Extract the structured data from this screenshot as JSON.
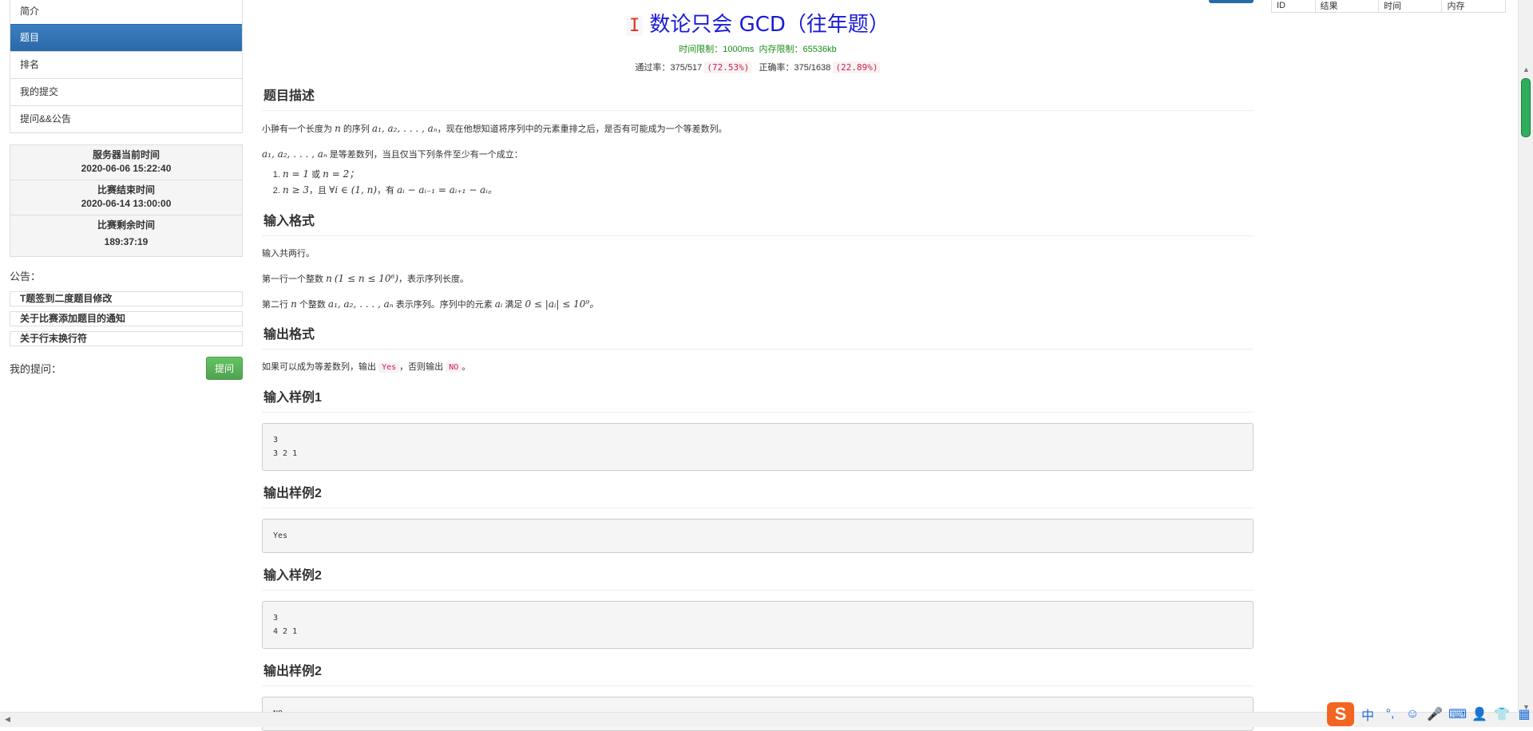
{
  "nav": {
    "items": [
      {
        "label": "简介",
        "active": false
      },
      {
        "label": "题目",
        "active": true
      },
      {
        "label": "排名",
        "active": false
      },
      {
        "label": "我的提交",
        "active": false
      },
      {
        "label": "提问&&公告",
        "active": false
      }
    ]
  },
  "times": {
    "server_label": "服务器当前时间",
    "server_value": "2020-06-06 15:22:40",
    "end_label": "比赛结束时间",
    "end_value": "2020-06-14 13:00:00",
    "remain_label": "比赛剩余时间",
    "remain_value": "189:37:19"
  },
  "announcements": {
    "title": "公告：",
    "items": [
      "T题签到二度题目修改",
      "关于比赛添加题目的通知",
      "关于行末换行符"
    ]
  },
  "my_questions": {
    "label": "我的提问：",
    "button": "提问"
  },
  "problem": {
    "letter": "I",
    "title": "数论只会 GCD（往年题）",
    "time_limit_label": "时间限制：",
    "time_limit": "1000ms",
    "memory_limit_label": "内存限制：",
    "memory_limit": "65536kb",
    "pass_label": "通过率：",
    "pass_value": "375/517",
    "pass_pct": "(72.53%)",
    "correct_label": "正确率：",
    "correct_value": "375/1638",
    "correct_pct": "(22.89%)"
  },
  "sections": {
    "description_title": "题目描述",
    "desc_p1_a": "小翀有一个长度为",
    "desc_p1_b": "的序列",
    "desc_p1_c": "，现在他想知道将序列中的元素重排之后，是否有可能成为一个等差数列。",
    "desc_p2": "是等差数列，当且仅当下列条件至少有一个成立：",
    "cond1_a": "或",
    "cond2_a": "，且",
    "cond2_b": "，有",
    "input_title": "输入格式",
    "input_p1": "输入共两行。",
    "input_p2_a": "第一行一个整数",
    "input_p2_b": "，表示序列长度。",
    "input_p3_a": "第二行",
    "input_p3_b": "个整数",
    "input_p3_c": "表示序列。序列中的元素",
    "input_p3_d": "满足",
    "output_title": "输出格式",
    "output_p1_a": "如果可以成为等差数列，输出",
    "output_yes": "Yes",
    "output_p1_b": "，否则输出",
    "output_no": "NO",
    "output_p1_c": "。"
  },
  "math": {
    "n": "n",
    "seq": "a₁, a₂, . . . , aₙ",
    "cond1_x": "n = 1",
    "cond1_y": "n = 2；",
    "cond2_x": "n ≥ 3",
    "cond2_y": "∀i ∈ (1, n)",
    "cond2_z": "aᵢ − aᵢ₋₁ = aᵢ₊₁ − aᵢ。",
    "n_range": "(1 ≤ n ≤ 10⁶)",
    "ai": "aᵢ",
    "ai_range": "0 ≤ |aᵢ| ≤ 10⁹。"
  },
  "samples": [
    {
      "title": "输入样例1",
      "content": "3\n3 2 1"
    },
    {
      "title": "输出样例2",
      "content": "Yes"
    },
    {
      "title": "输入样例2",
      "content": "3\n4 2 1"
    },
    {
      "title": "输出样例2",
      "content": "NO"
    }
  ],
  "submission_table": {
    "headers": [
      "ID",
      "结果",
      "时间",
      "内存"
    ]
  },
  "ime": {
    "logo": "S",
    "chars": [
      "中",
      "°,",
      "☺",
      "🎤",
      "⌨",
      "👤",
      "👕",
      "▦"
    ]
  }
}
